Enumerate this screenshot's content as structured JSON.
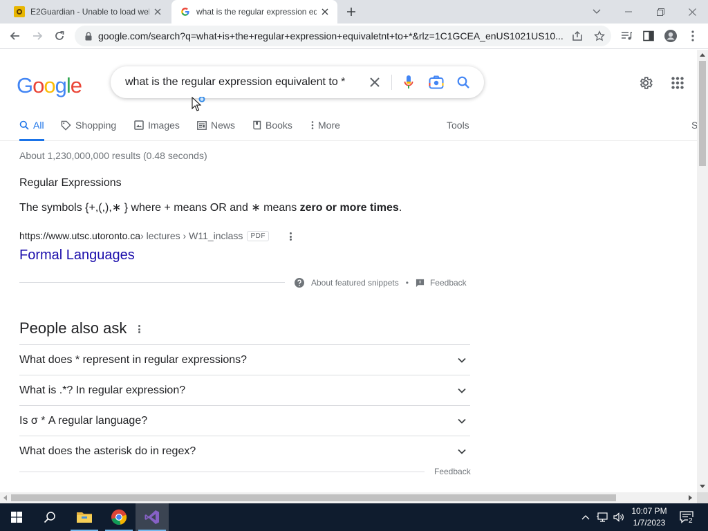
{
  "browser": {
    "tabs": [
      {
        "title": "E2Guardian - Unable to load web",
        "active": false
      },
      {
        "title": "what is the regular expression eq",
        "active": true
      }
    ],
    "url": "google.com/search?q=what+is+the+regular+expression+equivaletnt+to+*&rlz=1C1GCEA_enUS1021US10..."
  },
  "search": {
    "logo": "Google",
    "query": "what is the regular expression equivalent to *",
    "nav_tabs": [
      "All",
      "Shopping",
      "Images",
      "News",
      "Books",
      "More"
    ],
    "tools_label": "Tools",
    "edge_fragment": "S",
    "stats": "About 1,230,000,000 results (0.48 seconds)"
  },
  "featured_snippet": {
    "heading": "Regular Expressions",
    "text_before": "The symbols {+,(,),∗ } where + means OR and ∗ means ",
    "text_bold": "zero or more times",
    "text_after": ".",
    "site": "https://www.utsc.utoronto.ca",
    "path": " › lectures › W11_inclass",
    "filetype": "PDF",
    "link_title": "Formal Languages",
    "about_label": "About featured snippets",
    "separator": "•",
    "feedback_label": "Feedback"
  },
  "people_also_ask": {
    "title": "People also ask",
    "questions": [
      "What does * represent in regular expressions?",
      "What is .*? In regular expression?",
      "Is σ * A regular language?",
      "What does the asterisk do in regex?"
    ],
    "feedback_label": "Feedback"
  },
  "taskbar": {
    "time": "10:07 PM",
    "date": "1/7/2023",
    "notification_count": "2"
  },
  "colors": {
    "link": "#1a0dab",
    "accent": "#1a73e8",
    "google_blue": "#4285f4",
    "google_red": "#ea4335",
    "google_yellow": "#fbbc05",
    "google_green": "#34a853"
  }
}
